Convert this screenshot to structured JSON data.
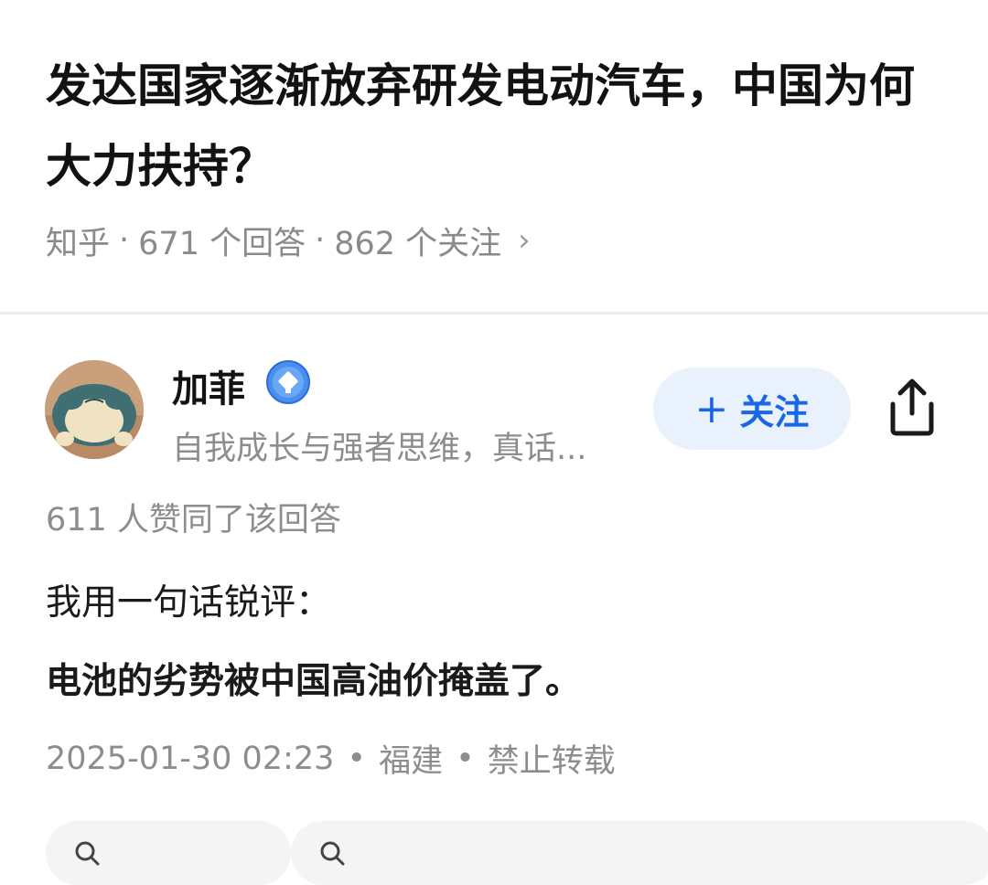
{
  "question": {
    "title": "发达国家逐渐放弃研发电动汽车，中国为何大力扶持？",
    "source": "知乎",
    "answers": "671 个回答",
    "followers": "862 个关注",
    "separator": "·",
    "chevron": "›"
  },
  "author": {
    "name": "加菲",
    "bio": "自我成长与强者思维，真话...",
    "avatar_icon": "avatar-snorlax",
    "verify_icon": "verified-badge-icon"
  },
  "actions": {
    "follow_plus": "+",
    "follow_label": "关注",
    "share_icon": "share-icon"
  },
  "answer": {
    "votes": "611 人赞同了该回答",
    "paragraphs": [
      "我用一句话锐评：",
      "电池的劣势被中国高油价掩盖了。"
    ],
    "timestamp": "2025-01-30 02:23",
    "location": "福建",
    "copyright": "禁止转载",
    "dot": "•"
  },
  "colors": {
    "accent": "#1966e6",
    "follow_bg": "#e9f1fd",
    "meta_text": "#8d8d8d",
    "divider": "#ececec"
  }
}
